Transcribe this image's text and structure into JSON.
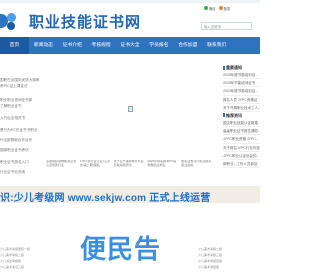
{
  "header": {
    "site_title": "职业技能证书网",
    "search_placeholder": "输入关键词",
    "user_links": [
      "微信",
      "登录"
    ]
  },
  "nav": {
    "items": [
      "首页",
      "新闻动态",
      "证书介绍",
      "考核规程",
      "证书大全",
      "学员报名",
      "合作加盟",
      "联系我们"
    ]
  },
  "left_list": {
    "lines": [
      "国职在京国际优质大赛审",
      "考PIC证上课证试",
      "职业职业咨询在书新",
      "了解职业证书",
      "入行后业相关书",
      "是行为PC在证书书职业",
      "PI出部基础合作合作",
      "国家职业证书考试",
      "职业证书报名入口",
      "行业证书业查询"
    ]
  },
  "thumbs": [
    "点我组织动物能源证书认定优势行业",
    "JYPC在行业认证 [江苏省(第二期)报名",
    "关于召开事务教育专业阶段指导研讨",
    "2025年级名报考PC指导教职业学生",
    "新职业教育行职业联系职业资格"
  ],
  "right_col": {
    "sections": [
      {
        "title": "重要通知",
        "items": [
          "2025年度节能培训证...",
          "2025年节能培训证书",
          "2024年度节能培训证...",
          "报名人员 JYPC资格证",
          "关于开展职业技术工人..."
        ]
      },
      {
        "title": "推荐资讯",
        "items": [
          "国企职业技能认证新建...",
          "高级职业证书报名通知...",
          "JYPC职业资格 JYPC...",
          "关于报名JYPC行业标准",
          "JYPC职业认证协会的...",
          "新职业 | 工作人员参加"
        ]
      }
    ]
  },
  "banner": {
    "text": "识:少儿考级网 www.sekjw.com 正式上线运营"
  },
  "bottom": {
    "left_lines": [
      "少儿美术考级国际一级",
      "少儿美术考级二级",
      "少儿书法考级级",
      "少儿美术考证三级"
    ],
    "right_lines": [
      "少儿美术考级二级",
      "少儿美术考级三级",
      "少儿美术考级四级",
      "少儿美术考级级"
    ],
    "watermark": "便民告"
  }
}
